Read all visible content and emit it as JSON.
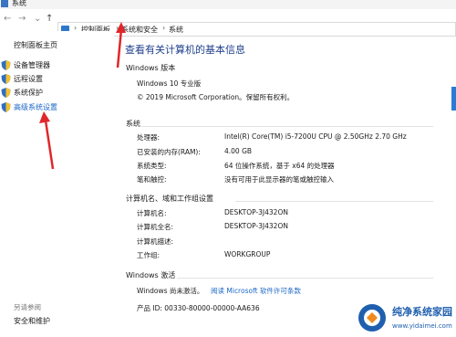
{
  "window": {
    "title": "系统"
  },
  "nav": {
    "back": "←",
    "forward": "→",
    "dropdown": "⌄",
    "up": "↑",
    "breadcrumbs": [
      "控制面板",
      "系统和安全",
      "系统"
    ],
    "separator": "›"
  },
  "sidebar": {
    "home": "控制面板主页",
    "items": [
      {
        "label": "设备管理器"
      },
      {
        "label": "远程设置"
      },
      {
        "label": "系统保护"
      },
      {
        "label": "高级系统设置"
      }
    ],
    "see_also": "另请参阅",
    "security_link": "安全和维护"
  },
  "main": {
    "heading": "查看有关计算机的基本信息",
    "edition": {
      "title": "Windows 版本",
      "name": "Windows 10 专业版",
      "copyright": "© 2019 Microsoft Corporation。保留所有权利。"
    },
    "system": {
      "title": "系统",
      "rows": [
        {
          "label": "处理器:",
          "value": "Intel(R) Core(TM) i5-7200U CPU @ 2.50GHz   2.70 GHz"
        },
        {
          "label": "已安装的内存(RAM):",
          "value": "4.00 GB"
        },
        {
          "label": "系统类型:",
          "value": "64 位操作系统，基于 x64 的处理器"
        },
        {
          "label": "笔和触控:",
          "value": "没有可用于此显示器的笔或触控输入"
        }
      ]
    },
    "computer": {
      "title": "计算机名、域和工作组设置",
      "rows": [
        {
          "label": "计算机名:",
          "value": "DESKTOP-3J432ON"
        },
        {
          "label": "计算机全名:",
          "value": "DESKTOP-3J432ON"
        },
        {
          "label": "计算机描述:",
          "value": ""
        },
        {
          "label": "工作组:",
          "value": "WORKGROUP"
        }
      ]
    },
    "activation": {
      "title": "Windows 激活",
      "status": "Windows 尚未激活。",
      "license_link": "阅读 Microsoft 软件许可条款",
      "product_id": "产品 ID: 00330-80000-00000-AA636"
    }
  },
  "watermark": {
    "text": "纯净系统家园",
    "url": "www.yidaimei.com"
  },
  "colors": {
    "link": "#1a66c4",
    "heading": "#1e3f8c",
    "arrow": "#e0262a",
    "accent": "#2b7bd6"
  }
}
